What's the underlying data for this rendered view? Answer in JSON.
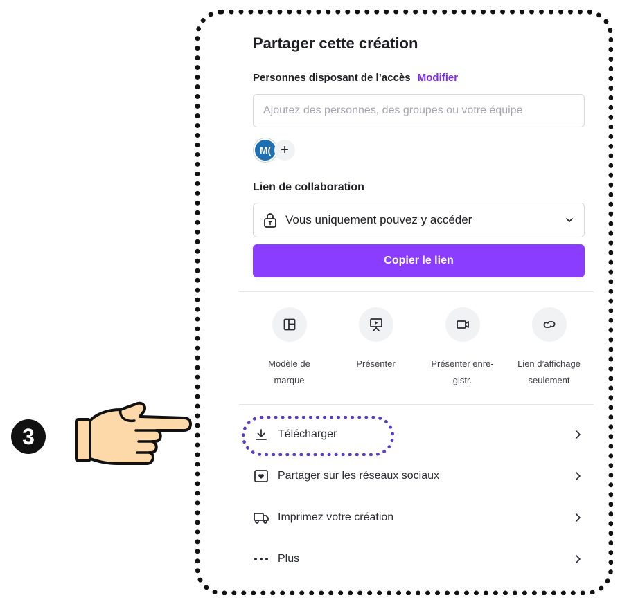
{
  "panel": {
    "title": "Partager cette création",
    "access_label": "Personnes disposant de l’accès",
    "modify_link": "Modifier",
    "people_input_placeholder": "Ajoutez des personnes, des groupes ou votre équipe",
    "avatar_initials": "M(",
    "add_person": "+",
    "collab_label": "Lien de collaboration",
    "access_select_value": "Vous uniquement pouvez y accéder",
    "copy_button": "Copier le lien"
  },
  "actions": [
    {
      "label": "Modèle de\nmarque",
      "icon": "brand-template-icon"
    },
    {
      "label": "Présenter",
      "icon": "present-icon"
    },
    {
      "label": "Présenter enre-\ngistr.",
      "icon": "record-icon"
    },
    {
      "label": "Lien d’affichage\nseulement",
      "icon": "link-icon"
    }
  ],
  "menu": [
    {
      "label": "Télécharger",
      "icon": "download-icon"
    },
    {
      "label": "Partager sur les réseaux sociaux",
      "icon": "heart-icon"
    },
    {
      "label": "Imprimez votre création",
      "icon": "truck-icon"
    },
    {
      "label": "Plus",
      "icon": "more-icon"
    }
  ],
  "annotation": {
    "step_number": "3"
  },
  "colors": {
    "accent": "#8b3dff",
    "link": "#7d2ae8",
    "highlight": "#5c3dc6",
    "avatar": "#1f6fb3"
  }
}
